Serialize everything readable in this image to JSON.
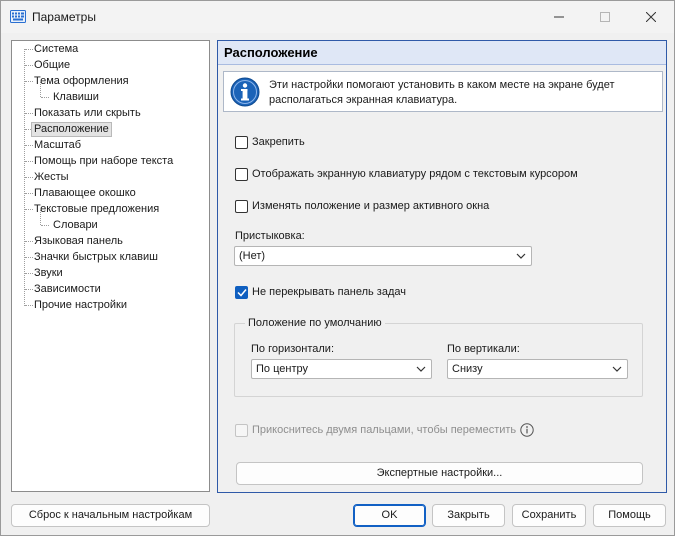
{
  "window": {
    "title": "Параметры",
    "icon": "keyboard-icon",
    "controls": [
      "minimize-icon",
      "maximize-icon",
      "close-icon"
    ]
  },
  "tree": {
    "items": [
      {
        "label": "Система",
        "level": 0
      },
      {
        "label": "Общие",
        "level": 0
      },
      {
        "label": "Тема оформления",
        "level": 0
      },
      {
        "label": "Клавиши",
        "level": 1
      },
      {
        "label": "Показать или скрыть",
        "level": 0
      },
      {
        "label": "Расположение",
        "level": 0,
        "selected": true
      },
      {
        "label": "Масштаб",
        "level": 0
      },
      {
        "label": "Помощь при наборе текста",
        "level": 0
      },
      {
        "label": "Жесты",
        "level": 0
      },
      {
        "label": "Плавающее окошко",
        "level": 0
      },
      {
        "label": "Текстовые предложения",
        "level": 0
      },
      {
        "label": "Словари",
        "level": 1
      },
      {
        "label": "Языковая панель",
        "level": 0
      },
      {
        "label": "Значки быстрых клавиш",
        "level": 0
      },
      {
        "label": "Звуки",
        "level": 0
      },
      {
        "label": "Зависимости",
        "level": 0
      },
      {
        "label": "Прочие настройки",
        "level": 0
      }
    ]
  },
  "panel": {
    "title": "Расположение",
    "info_text": "Эти настройки помогают установить в каком месте на экране будет располагаться экранная клавиатура.",
    "pin": {
      "label": "Закрепить",
      "checked": false
    },
    "near_cursor": {
      "label": "Отображать экранную клавиатуру рядом с текстовым курсором",
      "checked": false
    },
    "resize_active": {
      "label": "Изменять положение и размер активного окна",
      "checked": false
    },
    "docking": {
      "label": "Пристыковка:",
      "value": "(Нет)"
    },
    "no_overlap_taskbar": {
      "label": "Не перекрывать панель задач",
      "checked": true
    },
    "default_position": {
      "title": "Положение по умолчанию",
      "horizontal_label": "По горизонтали:",
      "horizontal_value": "По центру",
      "vertical_label": "По вертикали:",
      "vertical_value": "Снизу"
    },
    "two_finger": {
      "label": "Прикоснитесь двумя пальцами, чтобы переместить",
      "checked": false,
      "disabled": true
    },
    "expert_button": "Экспертные настройки..."
  },
  "footer": {
    "reset": "Сброс к начальным настройкам",
    "ok": "OK",
    "close": "Закрыть",
    "save": "Сохранить",
    "help": "Помощь"
  },
  "colors": {
    "accent": "#0f5fc0",
    "panel_header_bg": "#dfe7f6",
    "panel_border": "#2f5aa8"
  }
}
